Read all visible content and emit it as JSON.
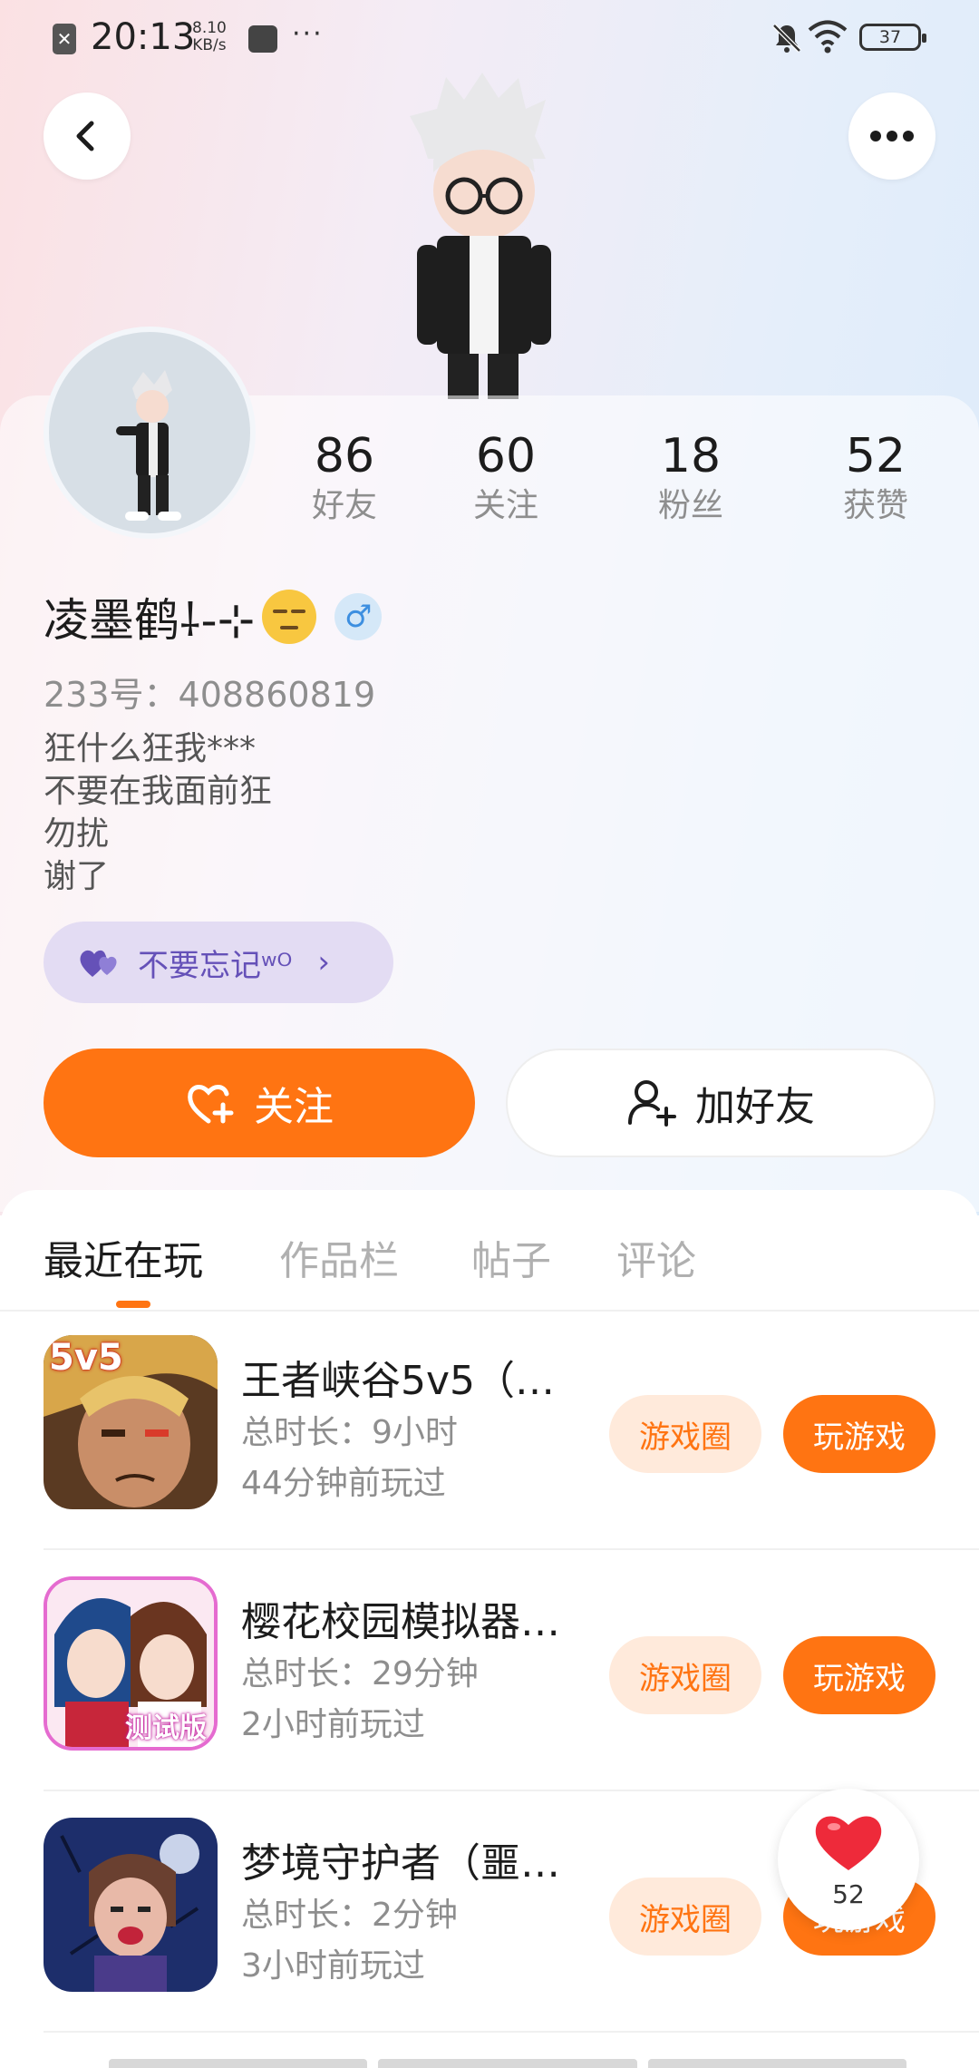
{
  "status_bar": {
    "time": "20:13",
    "net_speed_value": "8.10",
    "net_speed_unit": "KB/s",
    "more": "···",
    "battery": "37"
  },
  "profile": {
    "stats": [
      {
        "value": "86",
        "label": "好友"
      },
      {
        "value": "60",
        "label": "关注"
      },
      {
        "value": "18",
        "label": "粉丝"
      },
      {
        "value": "52",
        "label": "获赞"
      }
    ],
    "name": "凌墨鹤⸸-⊹",
    "gender_symbol": "♂",
    "uid": "233号：408860819",
    "bio_lines": [
      "狂什么狂我***",
      "不要在我面前狂",
      "勿扰",
      "谢了"
    ],
    "tag": "不要忘记ʷᴼ",
    "tag_chevron": "›",
    "follow_label": "关注",
    "add_friend_label": "加好友"
  },
  "tabs": [
    "最近在玩",
    "作品栏",
    "帖子",
    "评论"
  ],
  "games": [
    {
      "title": "王者峡谷5v5（…",
      "total_time": "总时长：9小时",
      "last_played": "44分钟前玩过",
      "icon_badge": "5v5",
      "circle_label": "游戏圈",
      "play_label": "玩游戏"
    },
    {
      "title": "樱花校园模拟器…",
      "total_time": "总时长：29分钟",
      "last_played": "2小时前玩过",
      "icon_badge": "测试版",
      "circle_label": "游戏圈",
      "play_label": "玩游戏"
    },
    {
      "title": "梦境守护者（噩…",
      "total_time": "总时长：2分钟",
      "last_played": "3小时前玩过",
      "icon_badge": "",
      "circle_label": "游戏圈",
      "play_label": "玩游戏"
    }
  ],
  "like_fab": {
    "count": "52"
  },
  "colors": {
    "accent": "#ff7412",
    "accent_soft": "#ffeadb",
    "tag_bg": "#e3dcf3",
    "tag_text": "#6551b8"
  }
}
